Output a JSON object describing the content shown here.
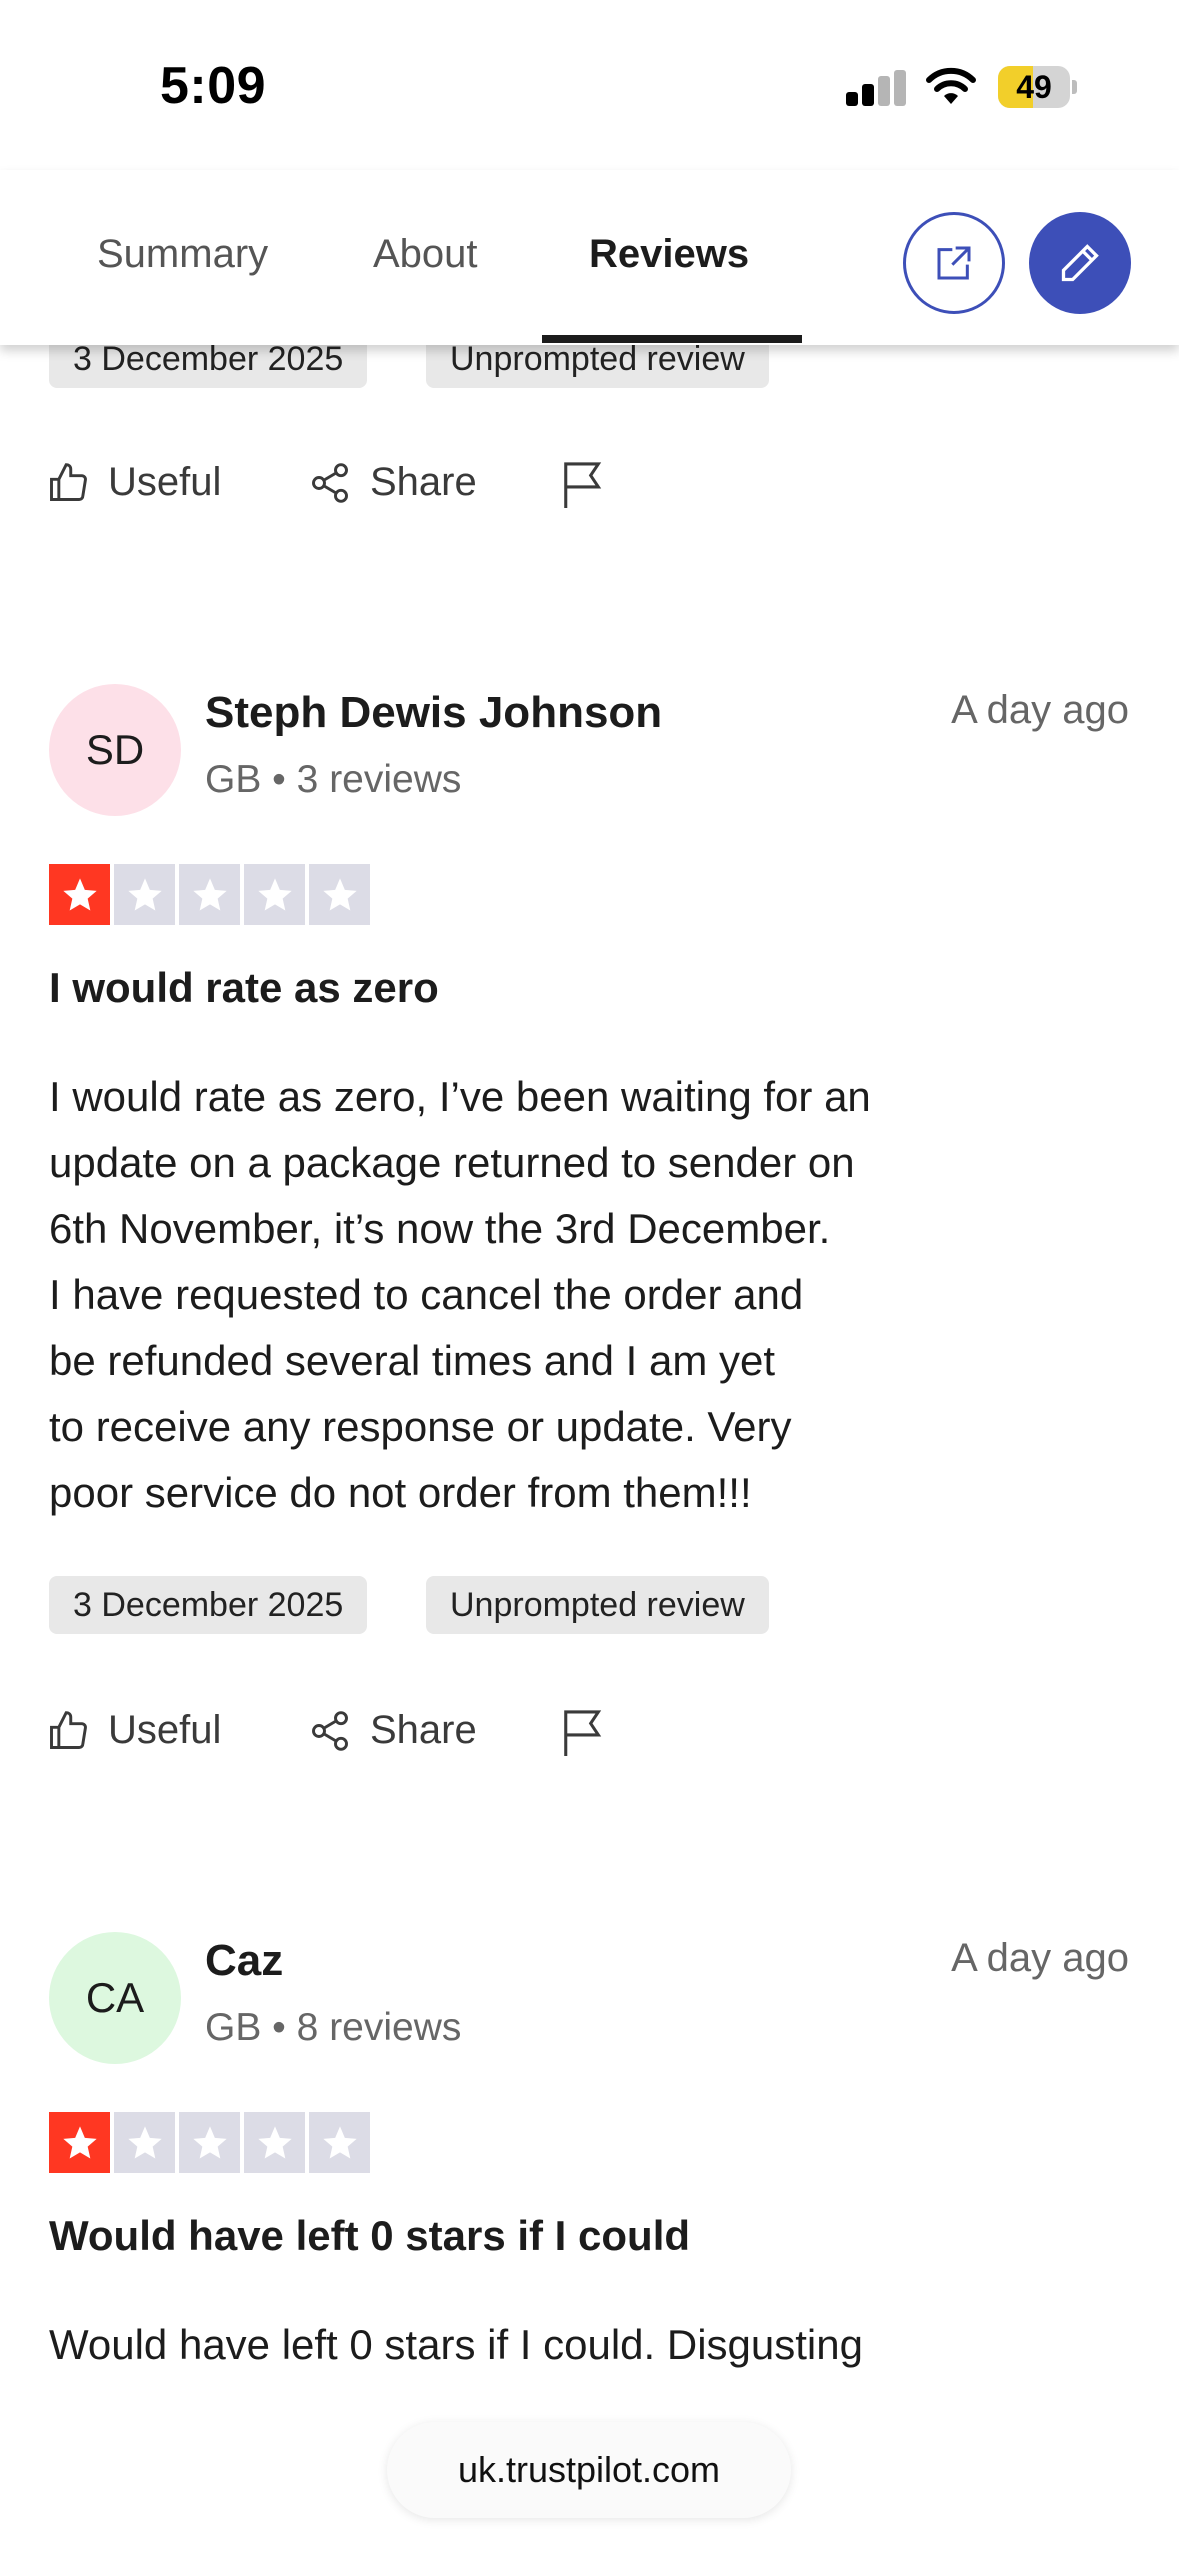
{
  "status_bar": {
    "time": "5:09",
    "battery_level": "49",
    "battery_fraction": 0.49
  },
  "tabs": [
    {
      "label": "Summary",
      "active": false
    },
    {
      "label": "About",
      "active": false
    },
    {
      "label": "Reviews",
      "active": true
    }
  ],
  "header_icons": {
    "open_external": "external-link-icon",
    "write_review": "pencil-icon",
    "accent_color": "#3d4fb8"
  },
  "previous_review": {
    "date_chip": "3 December 2025",
    "type_chip": "Unprompted review"
  },
  "actions": {
    "useful": "Useful",
    "share": "Share",
    "report_icon": "flag-icon"
  },
  "reviews": [
    {
      "initials": "SD",
      "avatar_color": "#fde0e8",
      "name": "Steph Dewis Johnson",
      "meta": "GB • 3 reviews",
      "time_ago": "A day ago",
      "rating": 1,
      "title": "I would rate as zero",
      "body_lines": [
        "I would rate as zero, I’ve been waiting for an",
        "update on a package returned to sender on",
        "6th November, it’s now the 3rd December.",
        "I have requested to cancel the order and",
        "be refunded several times and I am yet",
        "to receive any response or update. Very",
        "poor service do not order from them!!!"
      ],
      "date_chip": "3 December 2025",
      "type_chip": "Unprompted review"
    },
    {
      "initials": "CA",
      "avatar_color": "#ddf8df",
      "name": "Caz",
      "meta": "GB • 8 reviews",
      "time_ago": "A day ago",
      "rating": 1,
      "title": "Would have left 0 stars if I could",
      "body_lines": [
        "Would have left 0 stars if I could. Disgusting"
      ]
    }
  ],
  "star_colors": {
    "filled": "#ff3722",
    "empty": "#dcdce6"
  },
  "url_bar": {
    "url": "uk.trustpilot.com"
  }
}
